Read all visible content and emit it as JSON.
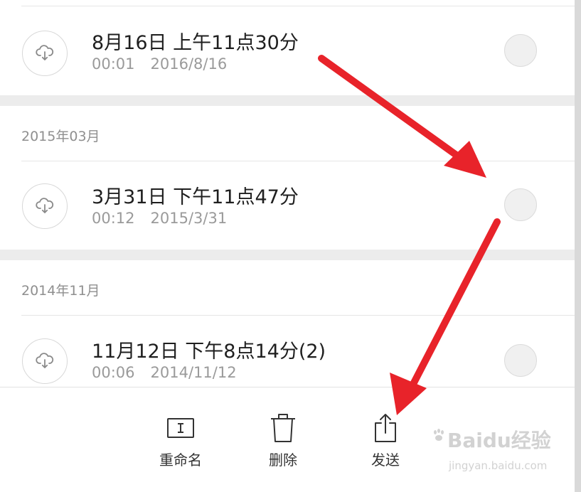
{
  "sections": [
    {
      "header": "",
      "items": [
        {
          "title": "8月16日 上午11点30分",
          "duration": "00:01",
          "date": "2016/8/16"
        }
      ]
    },
    {
      "header": "2015年03月",
      "items": [
        {
          "title": "3月31日 下午11点47分",
          "duration": "00:12",
          "date": "2015/3/31"
        }
      ]
    },
    {
      "header": "2014年11月",
      "items": [
        {
          "title": "11月12日 下午8点14分(2)",
          "duration": "00:06",
          "date": "2014/11/12"
        }
      ]
    }
  ],
  "toolbar": {
    "rename_label": "重命名",
    "delete_label": "删除",
    "send_label": "发送"
  },
  "watermark": {
    "brand": "Baidu经验",
    "url": "jingyan.baidu.com"
  },
  "colors": {
    "arrow": "#e8232a",
    "background": "#ececec",
    "panel": "#ffffff",
    "select_circle": "#f0f0f0"
  },
  "icons": {
    "record_item": "cloud-download-icon",
    "rename": "rename-icon",
    "delete": "trash-icon",
    "send": "share-icon"
  }
}
